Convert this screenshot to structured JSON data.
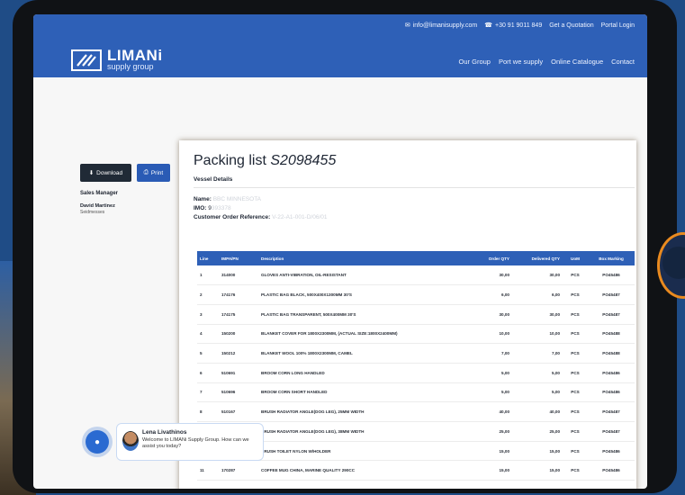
{
  "header": {
    "email": "info@limanisupply.com",
    "phone": "+30 91 9011 849",
    "quote_link": "Get a Quotation",
    "portal_link": "Portal Login",
    "logo_name": "LIMANi",
    "logo_sub": "supply group",
    "nav": [
      "Our Group",
      "Port we supply",
      "Online Catalogue",
      "Contact"
    ]
  },
  "sidebar": {
    "download_label": "Download",
    "print_label": "Print",
    "role": "Sales Manager",
    "person_name": "David Martinez",
    "person_sub": "Seidmesses"
  },
  "document": {
    "title_prefix": "Packing list",
    "title_number": "S2098455",
    "section": "Vessel Details",
    "name_label": "Name:",
    "name_value": "BBC MINNESOTA",
    "imo_label": "IMO:",
    "imo_value": "9",
    "imo_blurred": "393378",
    "ref_label": "Customer Order Reference:",
    "ref_value": "V-22-A1-001-D/06/01"
  },
  "table": {
    "headers": [
      "Line",
      "IMPA/PN",
      "Description",
      "Order QTY",
      "Delivered QTY",
      "UoM",
      "Box Marking"
    ],
    "rows": [
      [
        "1",
        "314000",
        "GLOVES ANTI-VIBRATION, OIL-RESISTANT",
        "30,00",
        "30,00",
        "PCS",
        "PO45486"
      ],
      [
        "2",
        "174176",
        "PLASTIC BAG BLACK, 500X400X1300MM 30'S",
        "6,00",
        "6,00",
        "PCS",
        "PO45487"
      ],
      [
        "3",
        "174175",
        "PLASTIC BAG TRANSPARENT, 500X400MM 30'S",
        "30,00",
        "30,00",
        "PCS",
        "PO45487"
      ],
      [
        "4",
        "150200",
        "BLANKET COVER FOR 1800X2300MM, (ACTUAL SIZE:1800X2400MM)",
        "10,00",
        "10,00",
        "PCS",
        "PO45488"
      ],
      [
        "5",
        "150212",
        "BLANKET WOOL 100% 1800X2300MM, CAMEL",
        "7,00",
        "7,00",
        "PCS",
        "PO45488"
      ],
      [
        "6",
        "510691",
        "BROOM CORN LONG HANDLED",
        "5,00",
        "5,00",
        "PCS",
        "PO45486"
      ],
      [
        "7",
        "510696",
        "BROOM CORN SHORT HANDLED",
        "5,00",
        "5,00",
        "PCS",
        "PO45486"
      ],
      [
        "8",
        "510167",
        "BRUSH RADIATOR ANGLE(DOG LEG), 25MM WIDTH",
        "40,00",
        "40,00",
        "PCS",
        "PO45487"
      ],
      [
        "9",
        "510166",
        "BRUSH RADIATOR ANGLE(DOG LEG), 38MM WIDTH",
        "25,00",
        "25,00",
        "PCS",
        "PO45487"
      ],
      [
        "10",
        "510152",
        "BRUSH TOILET NYLON W/HOLDER",
        "15,00",
        "15,00",
        "PCS",
        "PO45486"
      ],
      [
        "11",
        "170287",
        "COFFEE MUG CHINA, MARINE QUALITY 290CC",
        "15,00",
        "15,00",
        "PCS",
        "PO45486"
      ]
    ]
  },
  "chat": {
    "agent_name": "Lena Livathinos",
    "message": "Welcome to LIMANi Supply Group. How can we assist you today?"
  }
}
